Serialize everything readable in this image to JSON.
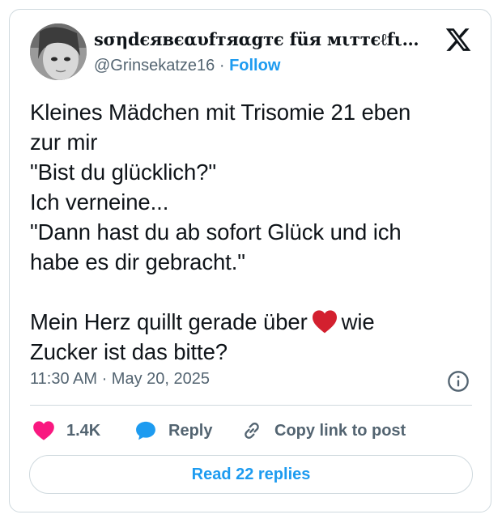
{
  "author": {
    "display_name": "sσηdєявєαυfтяαgтє füя мιттєℓfιηgєяα...",
    "handle": "@Grinsekatze16",
    "separator": "·",
    "follow_label": "Follow"
  },
  "tweet": {
    "lines": [
      "Kleines Mädchen mit Trisomie 21 eben",
      "zur mir",
      "\"Bist du glücklich?\"",
      "Ich verneine...",
      "\"Dann hast du ab sofort Glück und ich",
      "habe es dir gebracht.\""
    ],
    "line7_before": "Mein Herz quillt gerade über",
    "line7_after": "wie",
    "line8": "Zucker ist das bitte?",
    "timestamp": "11:30 AM · May 20, 2025"
  },
  "actions": {
    "like_count": "1.4K",
    "reply_label": "Reply",
    "copy_label": "Copy link to post"
  },
  "read_replies_label": "Read 22 replies",
  "colors": {
    "accent": "#1d9bf0",
    "like_pink": "#f91880",
    "reply_blue": "#1d9bf0",
    "heart_red": "#d3202f",
    "secondary_text": "#536471",
    "border": "#cfd9de"
  },
  "icons": [
    "x-logo-icon",
    "info-icon",
    "heart-icon",
    "reply-bubble-icon",
    "link-icon",
    "red-heart-emoji-icon"
  ]
}
